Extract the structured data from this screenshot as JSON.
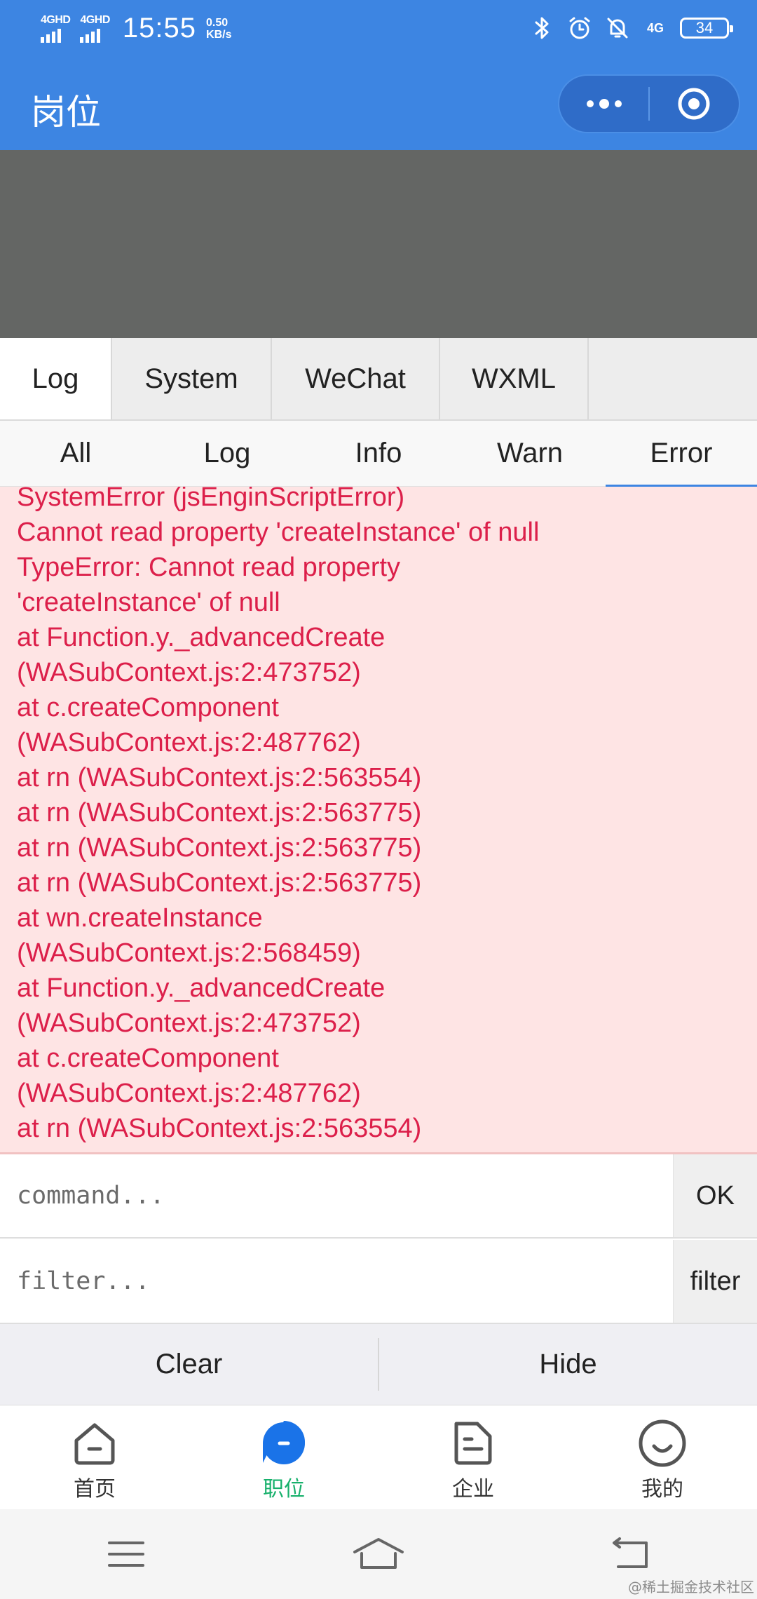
{
  "status_bar": {
    "network_1": "4GHD",
    "network_2": "4GHD",
    "time": "15:55",
    "speed_value": "0.50",
    "speed_unit": "KB/s",
    "network_right": "4G",
    "battery": "34"
  },
  "title_bar": {
    "title": "岗位"
  },
  "console": {
    "tabs": [
      "Log",
      "System",
      "WeChat",
      "WXML"
    ],
    "active_tab": "Log",
    "sub_tabs": [
      "All",
      "Log",
      "Info",
      "Warn",
      "Error"
    ],
    "active_sub_tab": "Error",
    "log_lines": [
      "SystemError (jsEnginScriptError)",
      "Cannot read property 'createInstance' of null",
      "TypeError: Cannot read property",
      "'createInstance' of null",
      "at Function.y._advancedCreate",
      "(WASubContext.js:2:473752)",
      "at c.createComponent",
      "(WASubContext.js:2:487762)",
      "at rn (WASubContext.js:2:563554)",
      "at rn (WASubContext.js:2:563775)",
      "at rn (WASubContext.js:2:563775)",
      "at rn (WASubContext.js:2:563775)",
      "at wn.createInstance",
      "(WASubContext.js:2:568459)",
      "at Function.y._advancedCreate",
      "(WASubContext.js:2:473752)",
      "at c.createComponent",
      "(WASubContext.js:2:487762)",
      "at rn (WASubContext.js:2:563554)"
    ],
    "command_placeholder": "command...",
    "command_button": "OK",
    "filter_placeholder": "filter...",
    "filter_button": "filter",
    "clear_label": "Clear",
    "hide_label": "Hide",
    "log_color": "#dc1f4a",
    "log_background": "#fee4e4"
  },
  "tab_bar": {
    "items": [
      {
        "label": "首页",
        "icon": "home-icon"
      },
      {
        "label": "职位",
        "icon": "job-icon"
      },
      {
        "label": "企业",
        "icon": "company-icon"
      },
      {
        "label": "我的",
        "icon": "profile-icon"
      }
    ],
    "active_index": 1,
    "active_color": "#16b06b"
  },
  "watermark": "@稀土掘金技术社区",
  "colors": {
    "brand": "#3d85e2",
    "active_tab_icon": "#1a73e8"
  }
}
